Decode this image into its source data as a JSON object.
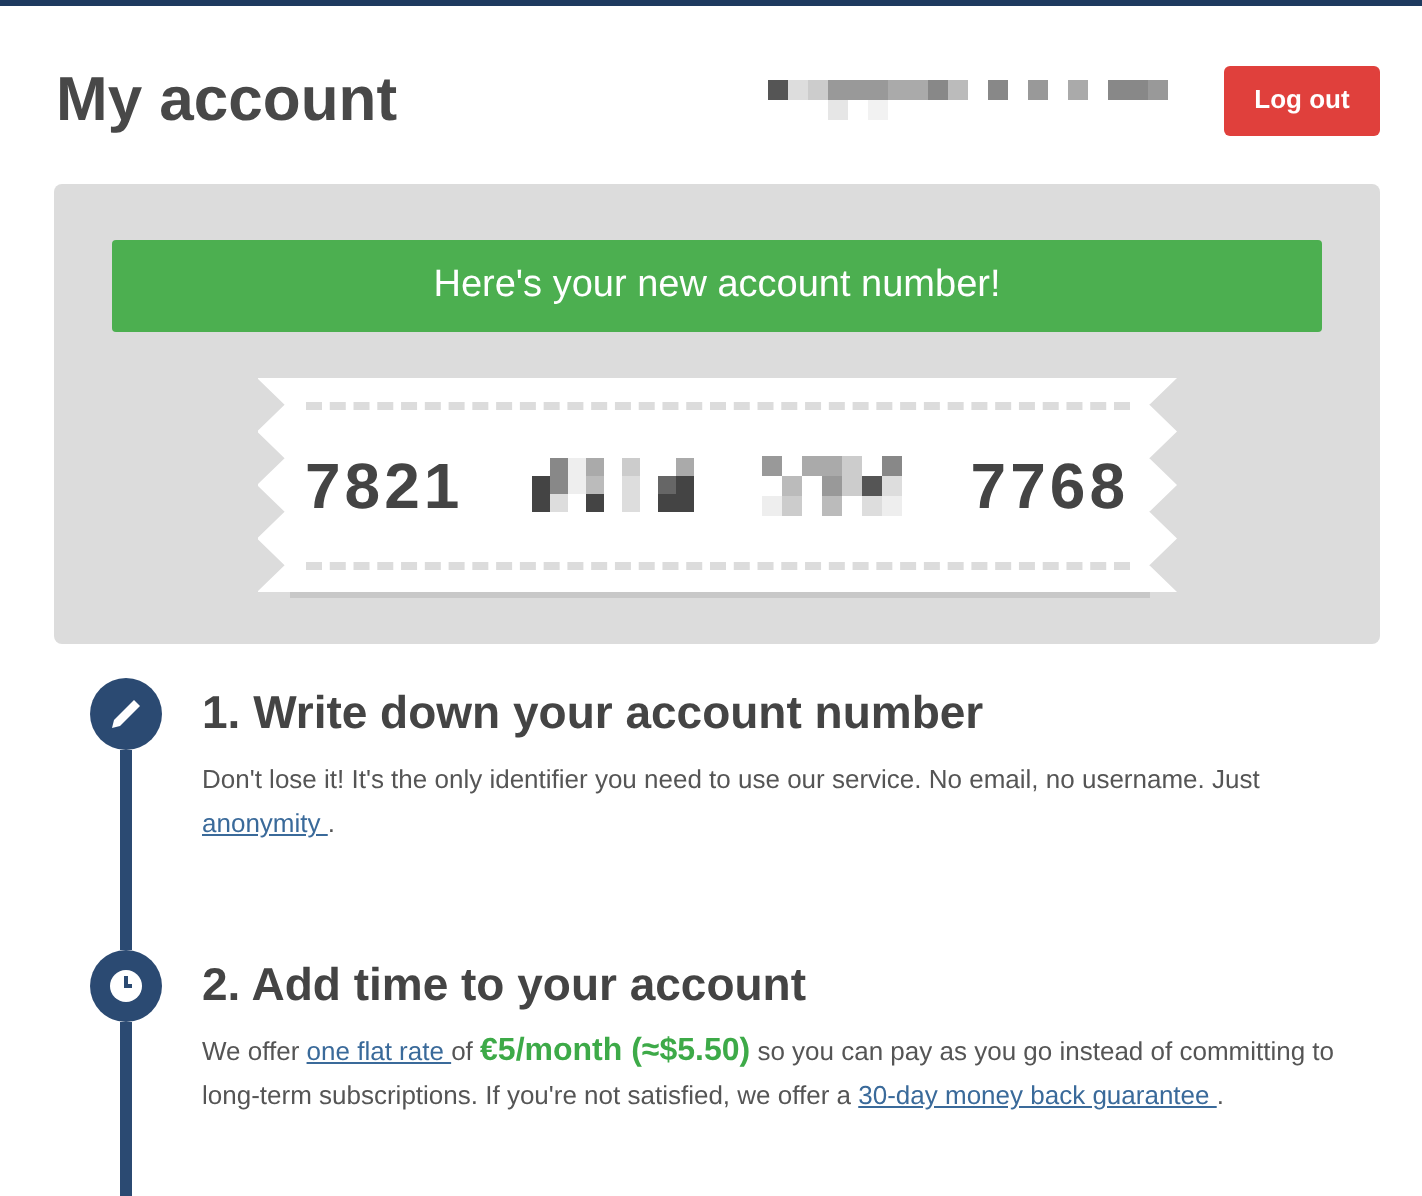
{
  "header": {
    "title": "My account",
    "logout_button": "Log out"
  },
  "account_panel": {
    "banner": "Here's your new account number!",
    "number_start": "7821",
    "number_end": "7768"
  },
  "steps": [
    {
      "title": "1. Write down your account number",
      "text": [
        {
          "kind": "text",
          "text": "Don't lose it! It's the only identifier you need to use our service. No email, no username. Just "
        },
        {
          "kind": "link",
          "text": "anonymity "
        },
        {
          "kind": "text",
          "text": "."
        }
      ]
    },
    {
      "title": "2. Add time to your account",
      "text": [
        {
          "kind": "text",
          "text": "We offer "
        },
        {
          "kind": "link",
          "text": "one flat rate "
        },
        {
          "kind": "text",
          "text": "of "
        },
        {
          "kind": "price",
          "text": "€5/month (≈$5.50)"
        },
        {
          "kind": "text",
          "text": " so you can pay as you go instead of committing to long-term subscriptions. If you're not satisfied, we offer a "
        },
        {
          "kind": "link",
          "text": "30-day money back guarantee "
        },
        {
          "kind": "text",
          "text": "."
        }
      ]
    }
  ]
}
